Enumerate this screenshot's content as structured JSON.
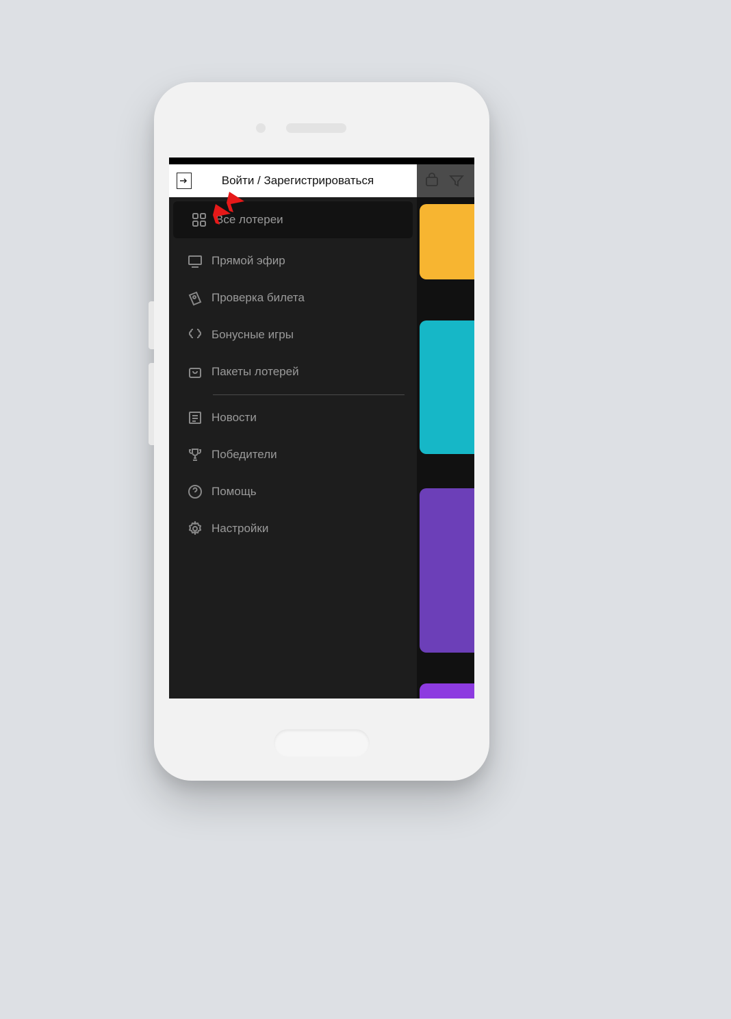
{
  "login": {
    "label": "Войти / Зарегистрироваться"
  },
  "menu": {
    "items": [
      {
        "label": "Все лотереи"
      },
      {
        "label": "Прямой эфир"
      },
      {
        "label": "Проверка билета"
      },
      {
        "label": "Бонусные игры"
      },
      {
        "label": "Пакеты лотерей"
      },
      {
        "label": "Новости"
      },
      {
        "label": "Победители"
      },
      {
        "label": "Помощь"
      },
      {
        "label": "Настройки"
      }
    ]
  }
}
